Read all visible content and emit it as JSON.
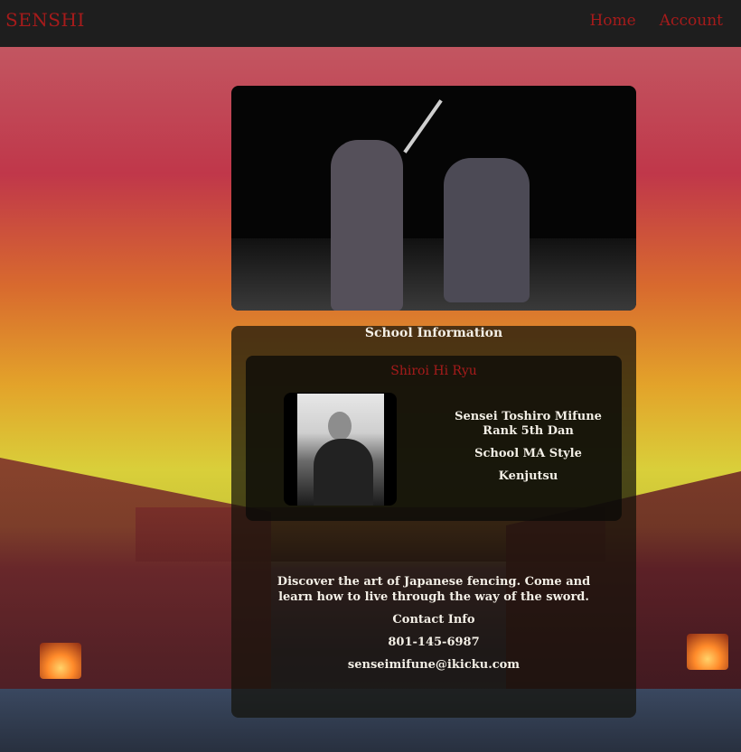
{
  "navbar": {
    "brand": "SENSHI",
    "links": [
      "Home",
      "Account"
    ]
  },
  "hero": {
    "alt": "Two kenjutsu practitioners sparring with swords on stage"
  },
  "info": {
    "heading": "School Information",
    "school_name": "Shiroi Hi Ryu",
    "sensei": "Sensei Toshiro Mifune",
    "rank": "Rank 5th Dan",
    "ma_style_label": "School MA Style",
    "style": "Kenjutsu",
    "description": "Discover the art of Japanese fencing. Come and learn how to live through the way of the sword.",
    "contact_label": "Contact Info",
    "phone": "801-145-6987",
    "email": "senseimifune@ikicku.com"
  },
  "colors": {
    "brand": "#a61b1b",
    "navbar": "#1e1e1e",
    "panel": "rgba(20,18,10,0.72)",
    "text": "#f3efe6"
  }
}
